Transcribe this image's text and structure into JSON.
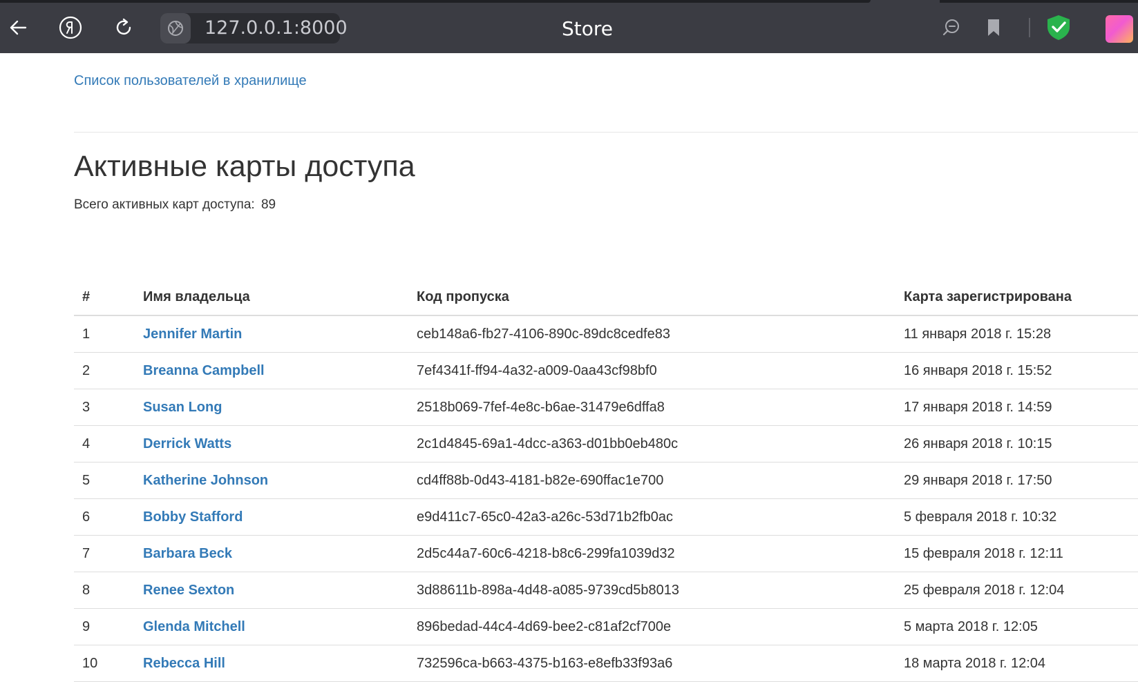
{
  "browser": {
    "url": "127.0.0.1:8000",
    "tab_title": "Store",
    "icons": [
      "back-arrow-icon",
      "yandex-logo-icon",
      "reload-icon",
      "site-globe-icon",
      "search-icon",
      "bookmark-icon",
      "protect-shield-icon",
      "profile-avatar"
    ],
    "colors": {
      "toolbar": "#3b3c43",
      "shield": "#2ab34d"
    }
  },
  "nav": {
    "users_link": "Список пользователей в хранилище"
  },
  "page": {
    "title": "Активные карты доступа",
    "summary_label": "Всего активных карт доступа:",
    "summary_count": "89"
  },
  "table": {
    "headers": [
      "#",
      "Имя владельца",
      "Код пропуска",
      "Карта зарегистрирована"
    ],
    "rows": [
      {
        "num": "1",
        "owner": "Jennifer Martin",
        "code": "ceb148a6-fb27-4106-890c-89dc8cedfe83",
        "registered": "11 января 2018 г. 15:28"
      },
      {
        "num": "2",
        "owner": "Breanna Campbell",
        "code": "7ef4341f-ff94-4a32-a009-0aa43cf98bf0",
        "registered": "16 января 2018 г. 15:52"
      },
      {
        "num": "3",
        "owner": "Susan Long",
        "code": "2518b069-7fef-4e8c-b6ae-31479e6dffa8",
        "registered": "17 января 2018 г. 14:59"
      },
      {
        "num": "4",
        "owner": "Derrick Watts",
        "code": "2c1d4845-69a1-4dcc-a363-d01bb0eb480c",
        "registered": "26 января 2018 г. 10:15"
      },
      {
        "num": "5",
        "owner": "Katherine Johnson",
        "code": "cd4ff88b-0d43-4181-b82e-690ffac1e700",
        "registered": "29 января 2018 г. 17:50"
      },
      {
        "num": "6",
        "owner": "Bobby Stafford",
        "code": "e9d411c7-65c0-42a3-a26c-53d71b2fb0ac",
        "registered": "5 февраля 2018 г. 10:32"
      },
      {
        "num": "7",
        "owner": "Barbara Beck",
        "code": "2d5c44a7-60c6-4218-b8c6-299fa1039d32",
        "registered": "15 февраля 2018 г. 12:11"
      },
      {
        "num": "8",
        "owner": "Renee Sexton",
        "code": "3d88611b-898a-4d48-a085-9739cd5b8013",
        "registered": "25 февраля 2018 г. 12:04"
      },
      {
        "num": "9",
        "owner": "Glenda Mitchell",
        "code": "896bedad-44c4-4d69-bee2-c81af2cf700e",
        "registered": "5 марта 2018 г. 12:05"
      },
      {
        "num": "10",
        "owner": "Rebecca Hill",
        "code": "732596ca-b663-4375-b163-e8efb33f93a6",
        "registered": "18 марта 2018 г. 12:04"
      }
    ]
  }
}
